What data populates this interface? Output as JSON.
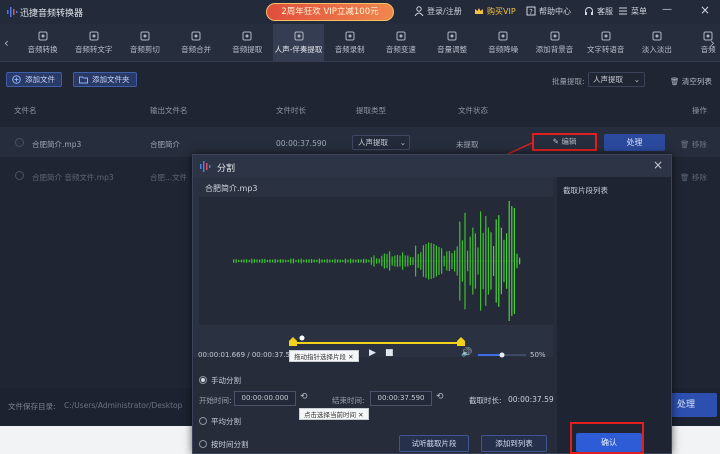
{
  "titlebar": {
    "app_title": "迅捷音频转换器",
    "promo": "2周年狂欢 VIP立减100元",
    "login": "登录/注册",
    "buy_vip": "购买VIP",
    "help": "帮助中心",
    "service": "客服",
    "menu": "菜单"
  },
  "tools": [
    {
      "label": "音频转换",
      "icon": "convert-icon"
    },
    {
      "label": "音频转文字",
      "icon": "text-icon"
    },
    {
      "label": "音频剪切",
      "icon": "scissors-icon"
    },
    {
      "label": "音频合并",
      "icon": "merge-icon"
    },
    {
      "label": "音频提取",
      "icon": "extract-icon"
    },
    {
      "label": "人声-伴奏提取",
      "icon": "vocal-icon"
    },
    {
      "label": "音频录制",
      "icon": "mic-icon"
    },
    {
      "label": "音频变速",
      "icon": "speed-icon"
    },
    {
      "label": "音量调整",
      "icon": "volume-icon"
    },
    {
      "label": "音频降噪",
      "icon": "denoise-icon"
    },
    {
      "label": "添加背景音",
      "icon": "bgm-icon"
    },
    {
      "label": "文字转语音",
      "icon": "tts-icon"
    },
    {
      "label": "淡入淡出",
      "icon": "fade-icon"
    },
    {
      "label": "音频",
      "icon": "audio-icon"
    }
  ],
  "actions": {
    "add_file": "添加文件",
    "add_folder": "添加文件夹",
    "batch_label": "批量提取:",
    "batch_value": "人声提取",
    "clear_list": "清空列表"
  },
  "table": {
    "headers": [
      "文件名",
      "输出文件名",
      "文件时长",
      "提取类型",
      "文件状态",
      "操作"
    ],
    "rows": [
      {
        "name": "合肥简介.mp3",
        "output": "合肥简介",
        "duration": "00:00:37.590",
        "type": "人声提取",
        "status": "未提取",
        "edit": "编辑",
        "process": "处理",
        "remove": "移除"
      },
      {
        "name": "合肥简介 音频文件.mp3",
        "output": "合肥...文件",
        "remove": "移除"
      }
    ]
  },
  "footer": {
    "save_label": "文件保存目录:",
    "save_path": "C:/Users/Administrator/Desktop",
    "process_all": "处理"
  },
  "dialog": {
    "title": "分割",
    "file_name": "合肥简介.mp3",
    "time_readout": "00:00:01.669 / 00:00:37.590",
    "drag_tip": "拖动指针选择片段",
    "volume_pct": "50%",
    "clip_list_title": "截取片段列表",
    "manual_split": "手动分割",
    "start_label": "开始时间:",
    "start_value": "00:00:00.000",
    "end_label": "结束时间:",
    "end_value": "00:00:37.590",
    "clip_duration_label": "截取时长:",
    "clip_duration_value": "00:00:37.59",
    "click_tip": "点击选择当前时间",
    "even_split": "平均分割",
    "time_split": "按时间分割",
    "preview_btn": "试听截取片段",
    "add_list_btn": "添加到列表",
    "confirm_btn": "确认",
    "playback_progress": 0.044,
    "volume_level": 0.5
  },
  "colors": {
    "accent_blue": "#2e5bd6",
    "highlight_red": "#e02020",
    "wave_green": "#3fbf2f",
    "selection_yellow": "#f2d21b"
  }
}
